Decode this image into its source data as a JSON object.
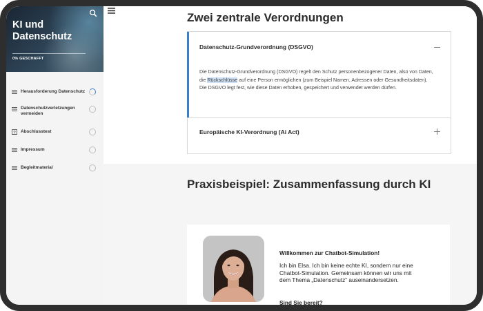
{
  "sidebar": {
    "course_title": "KI und Datenschutz",
    "progress_label": "0% GESCHAFFT",
    "items": [
      {
        "label": "Herausforderung Datenschutz",
        "icon": "list-icon",
        "status": "in-progress"
      },
      {
        "label": "Datenschutzverletzungen vermeiden",
        "icon": "list-icon",
        "status": "not-started"
      },
      {
        "label": "Abschlusstest",
        "icon": "quiz-icon",
        "status": "not-started"
      },
      {
        "label": "Impressum",
        "icon": "list-icon",
        "status": "not-started"
      },
      {
        "label": "Begleitmaterial",
        "icon": "list-icon",
        "status": "not-started"
      }
    ]
  },
  "main": {
    "section1_heading": "Zwei zentrale Verordnungen",
    "accordion": [
      {
        "title": "Datenschutz-Grundverordnung (DSGVO)",
        "expanded": true,
        "body_before": "Die Datenschutz-Grundverordnung (DSGVO) regelt den Schutz personenbezogener Daten, also von Daten, die ",
        "body_highlight": "Rückschlüsse",
        "body_after": " auf eine Person ermöglichen (zum Beispiel Namen, Adressen oder Gesundheitsdaten). Die DSGVO legt  fest, wie diese Daten erhoben, gespeichert und verwendet werden dürfen."
      },
      {
        "title": "Europäische KI-Verordnung (Ai Act)",
        "expanded": false
      }
    ],
    "section2_heading": "Praxisbeispiel: Zusammenfassung durch KI",
    "chat": {
      "greeting": "Willkommen zur Chatbot-Simulation!",
      "intro": "Ich bin Elsa. Ich bin keine echte KI, sondern nur eine Chatbot-Simulation. Gemeinsam können wir uns mit dem Thema „Datenschutz“ auseinandersetzen.",
      "question": "Sind Sie bereit?"
    }
  },
  "colors": {
    "accent": "#3b7ec9",
    "frame": "#2e2e2e",
    "sidebar_bg": "#f4f4f4",
    "heading": "#2b2b2b"
  }
}
